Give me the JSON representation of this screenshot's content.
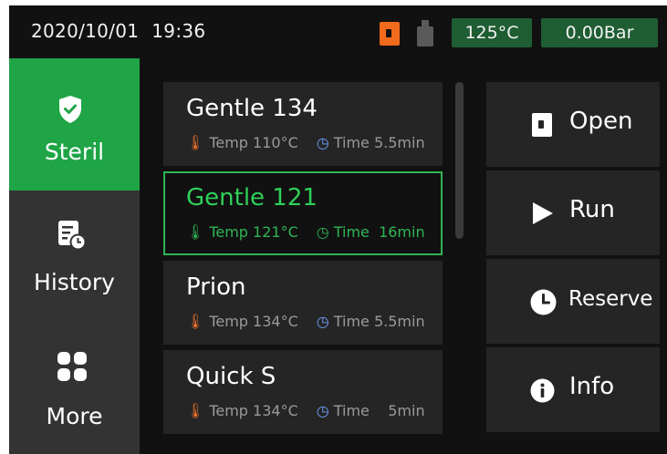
{
  "status": {
    "date": "2020/10/01",
    "time": "19:36",
    "temperature": "125°C",
    "pressure": "0.00Bar",
    "door_icon": "door-open-icon",
    "bottle_icon": "water-bottle-icon"
  },
  "sidebar": {
    "items": [
      {
        "label": "Steril",
        "icon": "shield-check-icon",
        "active": true
      },
      {
        "label": "History",
        "icon": "history-icon",
        "active": false
      },
      {
        "label": "More",
        "icon": "grid-icon",
        "active": false
      }
    ]
  },
  "programs": [
    {
      "name": "Gentle 134",
      "temp_label": "Temp",
      "temp": "110°C",
      "time_label": "Time",
      "time": "5.5min",
      "selected": false
    },
    {
      "name": "Gentle 121",
      "temp_label": "Temp",
      "temp": "121°C",
      "time_label": "Time",
      "time": "16min",
      "selected": true
    },
    {
      "name": "Prion",
      "temp_label": "Temp",
      "temp": "134°C",
      "time_label": "Time",
      "time": "5.5min",
      "selected": false
    },
    {
      "name": "Quick S",
      "temp_label": "Temp",
      "temp": "134°C",
      "time_label": "Time",
      "time": "5min",
      "selected": false
    }
  ],
  "actions": [
    {
      "label": "Open",
      "icon": "door-icon"
    },
    {
      "label": "Run",
      "icon": "play-icon"
    },
    {
      "label": "Reserve",
      "icon": "clock-icon"
    },
    {
      "label": "Info",
      "icon": "info-icon"
    }
  ],
  "colors": {
    "accent": "#1fa446",
    "selected_outline": "#2fb654",
    "status_pill": "#1f5d33",
    "door_icon": "#f26a1b",
    "background": "#111111",
    "sidebar": "#333333",
    "card": "#252525"
  }
}
